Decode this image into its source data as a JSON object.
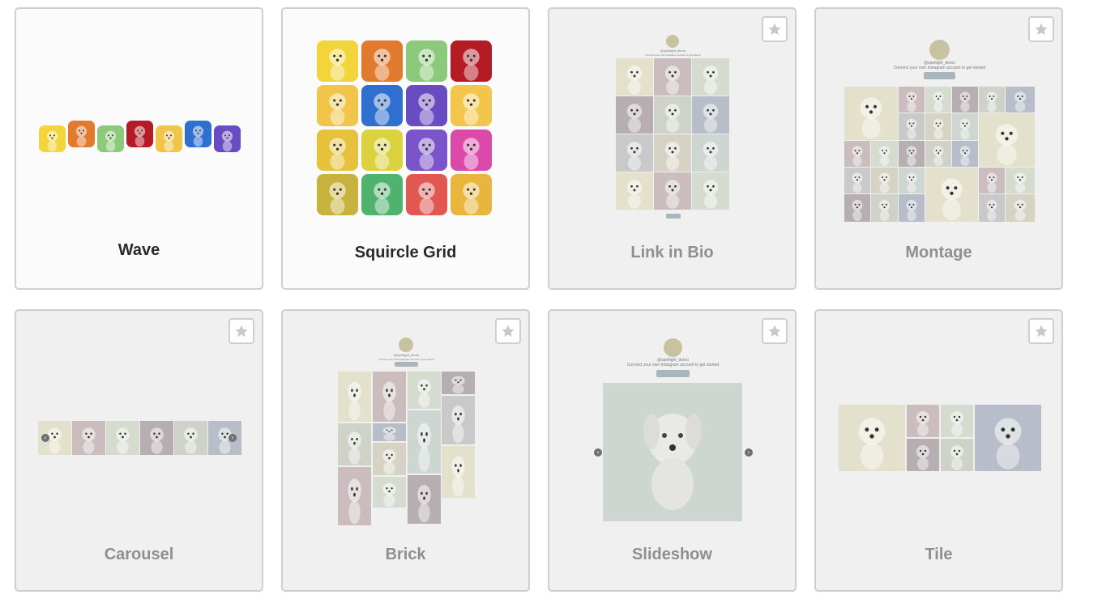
{
  "layouts": [
    {
      "id": "wave",
      "name": "Wave",
      "state": "available"
    },
    {
      "id": "squircle-grid",
      "name": "Squircle Grid",
      "state": "available"
    },
    {
      "id": "link-in-bio",
      "name": "Link in Bio",
      "state": "pro"
    },
    {
      "id": "montage",
      "name": "Montage",
      "state": "pro"
    },
    {
      "id": "carousel",
      "name": "Carousel",
      "state": "pro"
    },
    {
      "id": "brick",
      "name": "Brick",
      "state": "pro"
    },
    {
      "id": "slideshow",
      "name": "Slideshow",
      "state": "pro"
    },
    {
      "id": "tile",
      "name": "Tile",
      "state": "pro"
    }
  ],
  "colors": {
    "tile_colors": [
      "#f3d43a",
      "#e27a2e",
      "#8cc97a",
      "#b31c24",
      "#f0c54a",
      "#2f6fd0",
      "#6a4cc2",
      "#f2c64a",
      "#e6c13c",
      "#dad23f",
      "#7c54c9",
      "#db4aa8",
      "#c6b23d",
      "#4fb36d",
      "#e15752",
      "#e8b63d",
      "#e6e6e6",
      "#3db26a"
    ],
    "muted_colors": [
      "#e3e0cc",
      "#cbbcbd",
      "#d5dccf",
      "#b7aeb1",
      "#cfd2c8",
      "#b7bec9",
      "#c9c9c9",
      "#d7d3c4",
      "#cdd6d1"
    ]
  },
  "profile": {
    "handle": "@spotlight_demo",
    "subtitle": "Connect your own Instagram account to get started",
    "button": "Follow on Instagram"
  }
}
